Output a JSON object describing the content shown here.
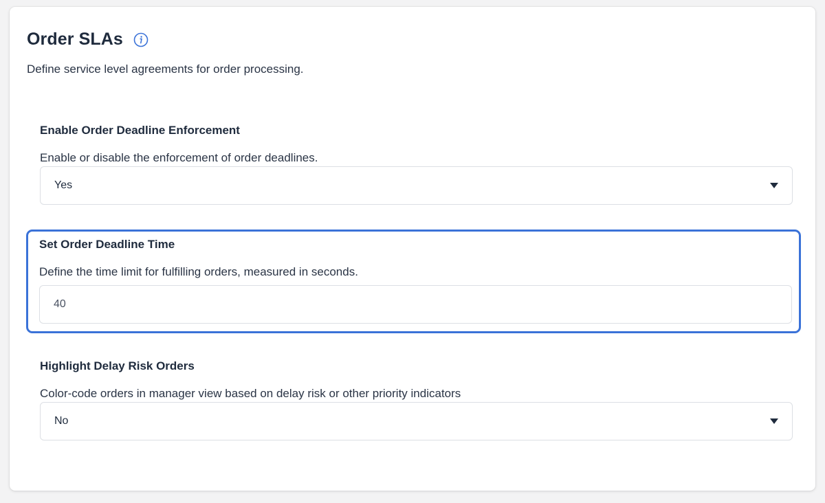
{
  "header": {
    "title": "Order SLAs",
    "subtitle": "Define service level agreements for order processing.",
    "info_icon": "info-icon"
  },
  "settings": [
    {
      "title": "Enable Order Deadline Enforcement",
      "description": "Enable or disable the enforcement of order deadlines.",
      "control": "select",
      "value": "Yes"
    },
    {
      "title": "Set Order Deadline Time",
      "description": "Define the time limit for fulfilling orders, measured in seconds.",
      "control": "input",
      "value": "40"
    },
    {
      "title": "Highlight Delay Risk Orders",
      "description": "Color-code orders in manager view based on delay risk or other priority indicators",
      "control": "select",
      "value": "No"
    }
  ],
  "colors": {
    "accent": "#3a72d8",
    "text": "#1f2b3d",
    "border": "#dcdfe4"
  }
}
